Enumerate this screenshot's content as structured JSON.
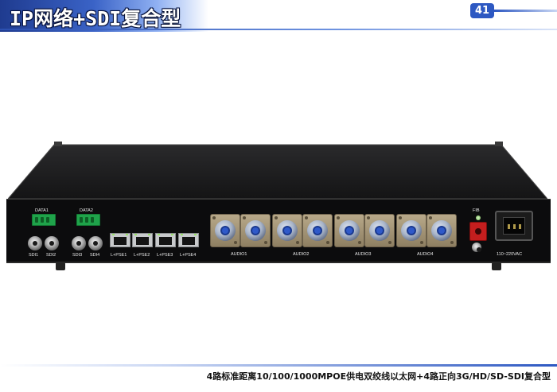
{
  "header": {
    "title": "IP网络+SDI复合型",
    "page_number": "41"
  },
  "device": {
    "data_labels": [
      "DATA1",
      "DATA2"
    ],
    "sdi_labels": [
      "SDI1",
      "SDI2",
      "SDI3",
      "SDI4"
    ],
    "ethernet_labels": [
      "L+PSE1",
      "L+PSE2",
      "L+PSE3",
      "L+PSE4"
    ],
    "audio_labels": [
      "AUDIO1",
      "AUDIO2",
      "AUDIO3",
      "AUDIO4"
    ],
    "fiber_label": "FIB",
    "power_label": "110~220VAC"
  },
  "caption": "4路标准距离10/100/1000MPOE供电双绞线以太网+4路正向3G/HD/SD-SDI复合型"
}
